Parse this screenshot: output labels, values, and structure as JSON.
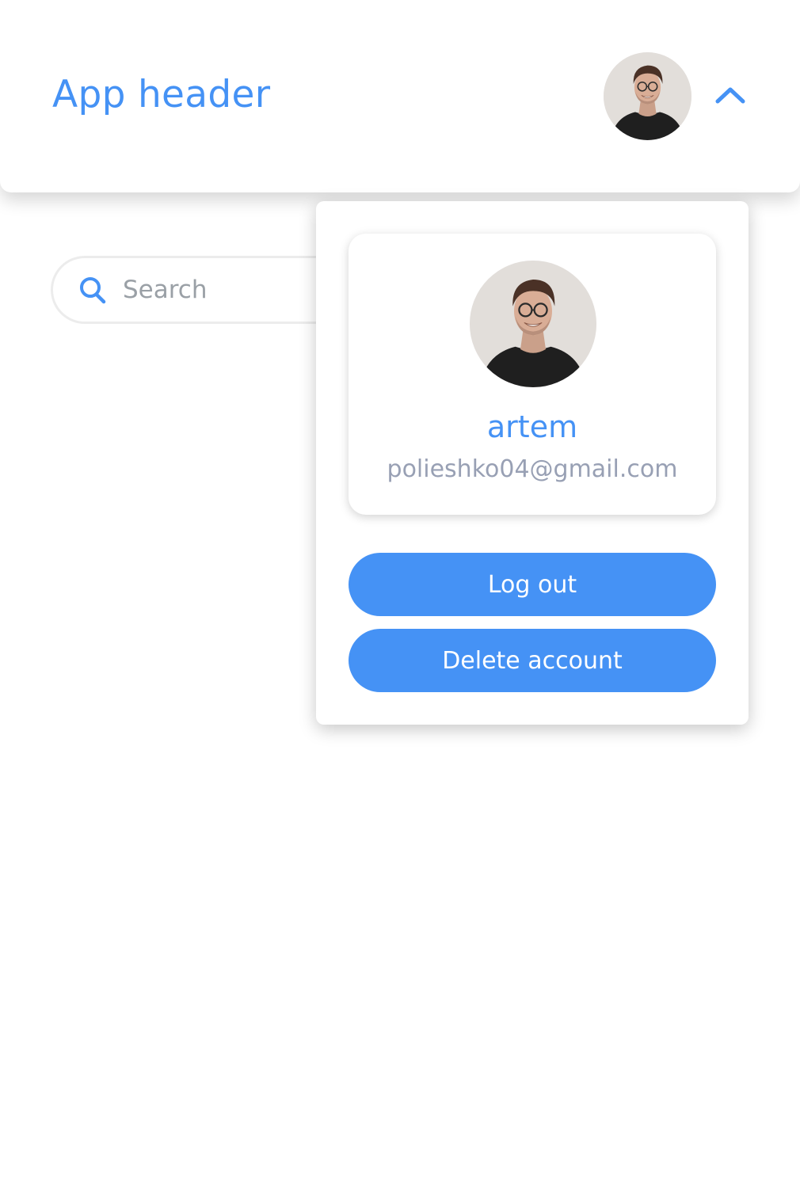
{
  "header": {
    "title": "App header",
    "avatar_icon": "user-avatar-photo",
    "toggle_icon": "chevron-up-icon",
    "accent_color": "#4592f5"
  },
  "search": {
    "placeholder": "Search",
    "value": "",
    "icon": "search-icon"
  },
  "profile_menu": {
    "expanded": true,
    "user": {
      "name": "artem",
      "email": "polieshko04@gmail.com"
    },
    "logout_label": "Log out",
    "delete_label": "Delete account"
  }
}
